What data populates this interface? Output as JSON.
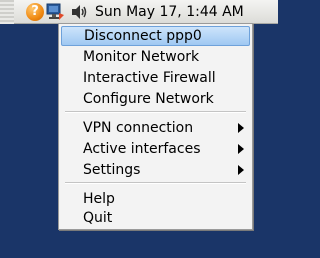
{
  "panel": {
    "clock": "Sun May 17,  1:44 AM",
    "icons": [
      "help-icon",
      "network-icon",
      "volume-icon"
    ],
    "help_glyph": "?"
  },
  "menu": {
    "items": [
      {
        "label": "Disconnect ppp0",
        "selected": true
      },
      {
        "label": "Monitor Network"
      },
      {
        "label": "Interactive Firewall"
      },
      {
        "label": "Configure Network"
      },
      {
        "label": "VPN connection",
        "submenu": true
      },
      {
        "label": "Active interfaces",
        "submenu": true
      },
      {
        "label": "Settings",
        "submenu": true
      },
      {
        "label": "Help"
      },
      {
        "label": "Quit"
      }
    ]
  },
  "colors": {
    "desktop": "#1a3568",
    "selection": "#9fc8f2",
    "menu_bg": "#f3f3f3"
  }
}
